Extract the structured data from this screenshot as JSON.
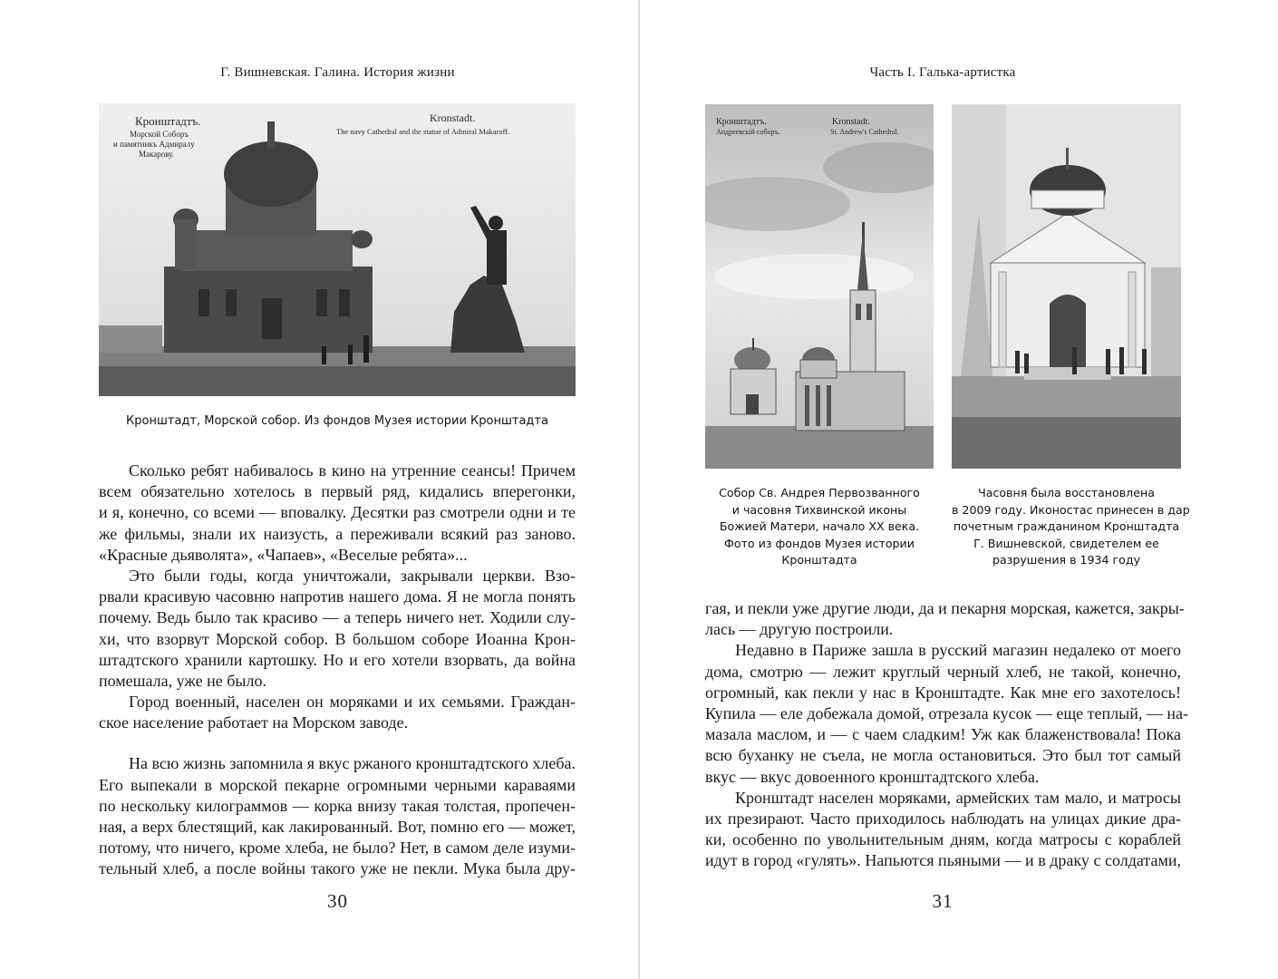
{
  "left_page": {
    "running_head": "Г. Вишневская. Галина. История жизни",
    "photo": {
      "postcard_text_ru": [
        "Кронштадтъ.",
        "Морской Соборъ",
        "и памятникъ Адмиралу",
        "Макарову."
      ],
      "postcard_text_en": [
        "Kronstadt.",
        "The navy Cathedral and the statue of Admiral Makaroff."
      ]
    },
    "caption": "Кронштадт, Морской собор. Из фондов Музея истории Кронштадта",
    "paragraphs": [
      [
        "Сколько ребят набивалось в кино на утренние сеансы! Причем",
        "всем обязательно хотелось в первый ряд, кидались впере­гонки,",
        "и я, конечно, со всеми — вповалку. Десятки раз смотрели одни и те",
        "же фильмы, знали их наизусть, а переживали всякий раз заново.",
        "«Красные дьяволята», «Чапаев», «Веселые ребята»..."
      ],
      [
        "Это были годы, когда уничтожали, закрывали церкви. Взо-",
        "рвали красивую часовню напротив нашего дома. Я не могла понять",
        "почему. Ведь было так красиво — а теперь ничего нет. Ходили слу-",
        "хи, что взорвут Морской собор. В большом соборе Иоанна Крон-",
        "штадтского хранили картошку. Но и его хотели взорвать, да война",
        "помешала, уже не было."
      ],
      [
        "Город военный, населен он моряками и их семьями. Граждан-",
        "ское население работает на Морском заводе."
      ],
      [
        "На всю жизнь запомнила я вкус ржаного кронштадтского хлеба.",
        "Его выпекали в морской пекарне огромными черными караваями",
        "по нескольку килограммов — корка внизу такая толстая, пропечен-",
        "ная, а верх блестящий, как лакированный. Вот, помню его — может,",
        "потому, что ничего, кроме хлеба, не было? Нет, в самом деле изуми-",
        "тельный хлеб, а после войны такого уже не пекли. Мука была дру-"
      ]
    ],
    "folio": "30"
  },
  "right_page": {
    "running_head": "Часть I. Галька-артистка",
    "photo_left": {
      "postcard_text_ru": [
        "Кронштадтъ.",
        "Андреевскій соборъ."
      ],
      "postcard_text_en": [
        "Kronstadt.",
        "St. Andrew's Cathedral."
      ]
    },
    "caption_left": [
      "Собор Св. Андрея Первозванного",
      "и часовня Тихвинской иконы",
      "Божией Матери, начало XX века.",
      "Фото из фондов Музея истории",
      "Кронштадта"
    ],
    "caption_right": [
      "Часовня была восстановлена",
      "в 2009 году. Иконостас принесен в дар",
      "почетным гражданином Кронштадта",
      "Г. Вишневской, свидетелем ее",
      "разрушения в 1934 году"
    ],
    "paragraphs": [
      [
        "гая, и пекли уже другие люди, да и пекарня морская, кажется, закры-",
        "лась — другую построили."
      ],
      [
        "Недавно в Париже зашла в русский магазин недалеко от моего",
        "дома, смотрю — лежит круглый черный хлеб, не такой, конечно,",
        "огромный, как пекли у нас в Кронштадте. Как мне его захотелось!",
        "Купила — еле добежала домой, отрезала кусок — еще теплый, — на-",
        "мазала маслом, и — с чаем сладким! Уж как блаженствовала! Пока",
        "всю буханку не съела, не могла остановиться. Это был тот самый",
        "вкус — вкус довоенного кронштадтского хлеба."
      ],
      [
        "Кронштадт населен моряками, армейских там мало, и матросы",
        "их презирают. Часто приходилось наблюдать на улицах дикие дра-",
        "ки, особенно по увольнительным дням, когда матросы с кораблей",
        "идут в город «гулять». Напьются пьяными — и в драку с солдатами,"
      ]
    ],
    "folio": "31"
  }
}
